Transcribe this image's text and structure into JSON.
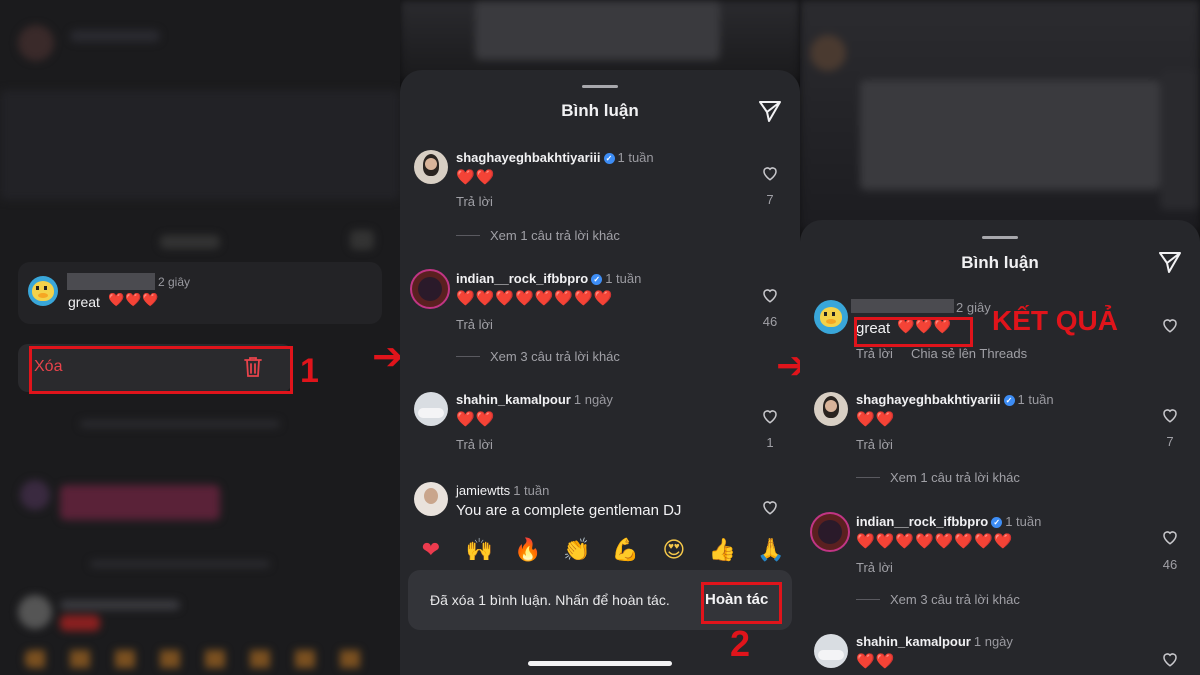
{
  "panel1": {
    "comment": {
      "time": "2 giây",
      "text": "great",
      "hearts": "❤️❤️❤️"
    },
    "menu": {
      "delete_label": "Xóa"
    },
    "step_number": "1"
  },
  "panel2": {
    "sheet_title": "Bình luận",
    "comments": [
      {
        "user": "shaghayeghbakhtiyariii",
        "time": "1 tuần",
        "text": "❤️❤️",
        "reply": "Trả lời",
        "likes": "7",
        "more": "Xem 1 câu trả lời khác"
      },
      {
        "user": "indian__rock_ifbbpro",
        "time": "1 tuần",
        "text": "❤️❤️❤️❤️❤️❤️❤️❤️",
        "reply": "Trả lời",
        "likes": "46",
        "more": "Xem 3 câu trả lời khác"
      },
      {
        "user": "shahin_kamalpour",
        "time": "1 ngày",
        "text": "❤️❤️",
        "reply": "Trả lời",
        "likes": "1"
      },
      {
        "user": "jamiewtts",
        "time": "1 tuần",
        "text": "You are a complete gentleman DJ"
      }
    ],
    "emojis": [
      "❤",
      "🙌",
      "🔥",
      "👏",
      "💪",
      "😍",
      "👍",
      "🙏"
    ],
    "toast": {
      "message": "Đã xóa 1 bình luận. Nhấn để hoàn tác.",
      "undo_label": "Hoàn tác"
    },
    "step_number": "2"
  },
  "panel3": {
    "sheet_title": "Bình luận",
    "result_label": "KẾT QUẢ",
    "own_comment": {
      "time": "2 giây",
      "text": "great",
      "hearts": "❤️❤️❤️",
      "reply": "Trả lời",
      "share": "Chia sẻ lên Threads"
    },
    "comments": [
      {
        "user": "shaghayeghbakhtiyariii",
        "time": "1 tuần",
        "text": "❤️❤️",
        "reply": "Trả lời",
        "likes": "7",
        "more": "Xem 1 câu trả lời khác"
      },
      {
        "user": "indian__rock_ifbbpro",
        "time": "1 tuần",
        "text": "❤️❤️❤️❤️❤️❤️❤️❤️",
        "reply": "Trả lời",
        "likes": "46",
        "more": "Xem 3 câu trả lời khác"
      },
      {
        "user": "shahin_kamalpour",
        "time": "1 ngày",
        "text": "❤️❤️"
      }
    ]
  },
  "colors": {
    "annotation_red": "#e0141b",
    "heart_red": "#ec3b4e",
    "verified_blue": "#3d8df5"
  }
}
